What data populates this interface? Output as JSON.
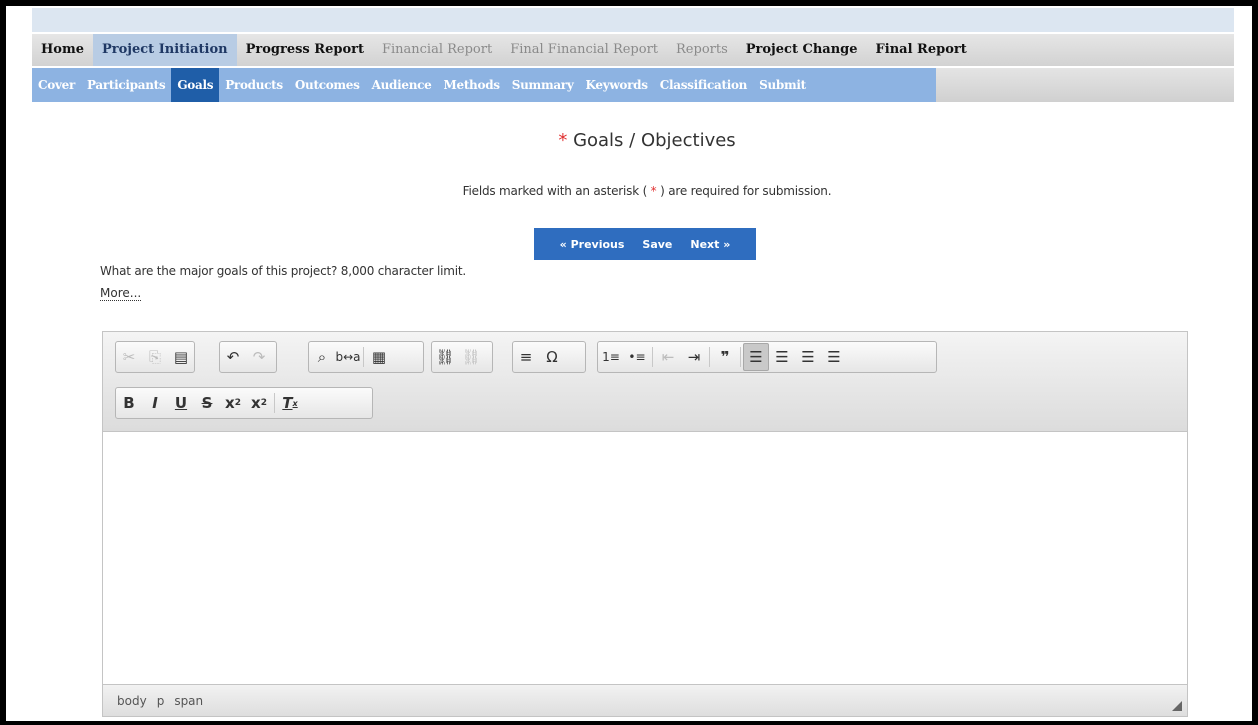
{
  "menu": [
    {
      "label": "Home",
      "state": "normal"
    },
    {
      "label": "Project Initiation",
      "state": "active"
    },
    {
      "label": "Progress Report",
      "state": "normal"
    },
    {
      "label": "Financial Report",
      "state": "disabled"
    },
    {
      "label": "Final Financial Report",
      "state": "disabled"
    },
    {
      "label": "Reports",
      "state": "disabled"
    },
    {
      "label": "Project Change",
      "state": "normal"
    },
    {
      "label": "Final Report",
      "state": "normal"
    }
  ],
  "subtabs": [
    "Cover",
    "Participants",
    "Goals",
    "Products",
    "Outcomes",
    "Audience",
    "Methods",
    "Summary",
    "Keywords",
    "Classification",
    "Submit"
  ],
  "active_subtab": "Goals",
  "page": {
    "required_mark": "*",
    "title": "Goals / Objectives",
    "notice_prefix": "Fields marked with an asterisk (",
    "notice_mark": " * ",
    "notice_suffix": ") are required for submission."
  },
  "buttons": {
    "previous": "« Previous",
    "save": "Save",
    "next": "Next »"
  },
  "question": "What are the major goals of this project? 8,000 character limit.",
  "more_link": "More...",
  "toolbar": {
    "row1": [
      [
        "cut-icon",
        "copy-icon",
        "paste-word-icon"
      ],
      [
        "undo-icon",
        "redo-icon"
      ],
      [
        "find-icon",
        "replace-icon",
        "select-all-icon"
      ],
      [
        "link-icon",
        "unlink-icon"
      ],
      [
        "horizontal-line-icon",
        "special-char-icon"
      ],
      [
        "numbered-list-icon",
        "bulleted-list-icon",
        "decrease-indent-icon",
        "increase-indent-icon",
        "blockquote-icon"
      ],
      [
        "align-left-icon",
        "align-center-icon",
        "align-right-icon",
        "justify-icon"
      ]
    ],
    "row2": [
      "bold-icon",
      "italic-icon",
      "underline-icon",
      "strike-icon",
      "subscript-icon",
      "superscript-icon",
      "remove-format-icon"
    ]
  },
  "statusbar": [
    "body",
    "p",
    "span"
  ]
}
